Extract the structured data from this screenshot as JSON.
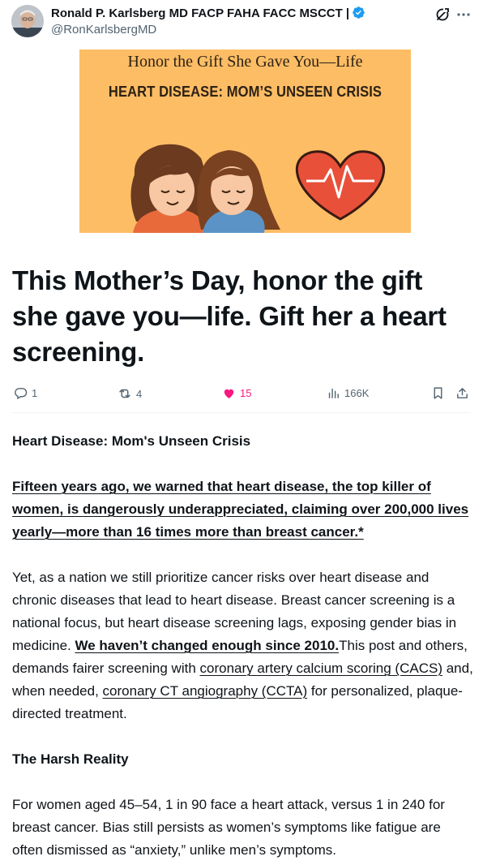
{
  "author": {
    "name": "Ronald P. Karlsberg MD FACP FAHA FACC MSCCT |",
    "handle": "@RonKarlsbergMD",
    "verified_icon": "verified-badge-icon"
  },
  "hero": {
    "title": "Honor the Gift She Gave You—Life",
    "subtitle": "HEART DISEASE: MOM’S UNSEEN CRISIS"
  },
  "tweet": {
    "text": "This Mother’s Day, honor the gift she gave you—life. Gift her a heart screening."
  },
  "actions": {
    "replies": "1",
    "reposts": "4",
    "likes": "15",
    "views": "166K"
  },
  "colors": {
    "like": "#f91880",
    "muted": "#536471",
    "verified": "#1d9bf0",
    "hero_bg": "#fdbd65"
  },
  "article": {
    "heading1": "Heart Disease:  Mom's Unseen Crisis",
    "para1": "Fifteen years ago, we warned that heart disease, the top killer of women, is dangerously underappreciated, claiming over 200,000 lives yearly—more than 16 times more than breast cancer.*",
    "para2_a": "Yet, as a nation we still prioritize cancer risks over heart disease and chronic diseases that lead to heart disease. Breast cancer screening is a national focus, but heart disease screening lags, exposing gender bias in medicine. ",
    "para2_bold_link": "We haven’t changed enough since 2010.",
    "para2_b": "This post and others, demands fairer screening with ",
    "para2_link1": "coronary artery calcium scoring (CACS)",
    "para2_c": " and, when needed, ",
    "para2_link2": "coronary CT angiography (CCTA)",
    "para2_d": " for personalized, plaque-directed treatment.",
    "heading2": "The Harsh Reality",
    "para3": "For women aged 45–54, 1 in 90 face a heart attack, versus 1 in 240 for breast cancer. Bias still persists as women’s symptoms like fatigue are often dismissed as “anxiety,” unlike men’s symptoms."
  }
}
